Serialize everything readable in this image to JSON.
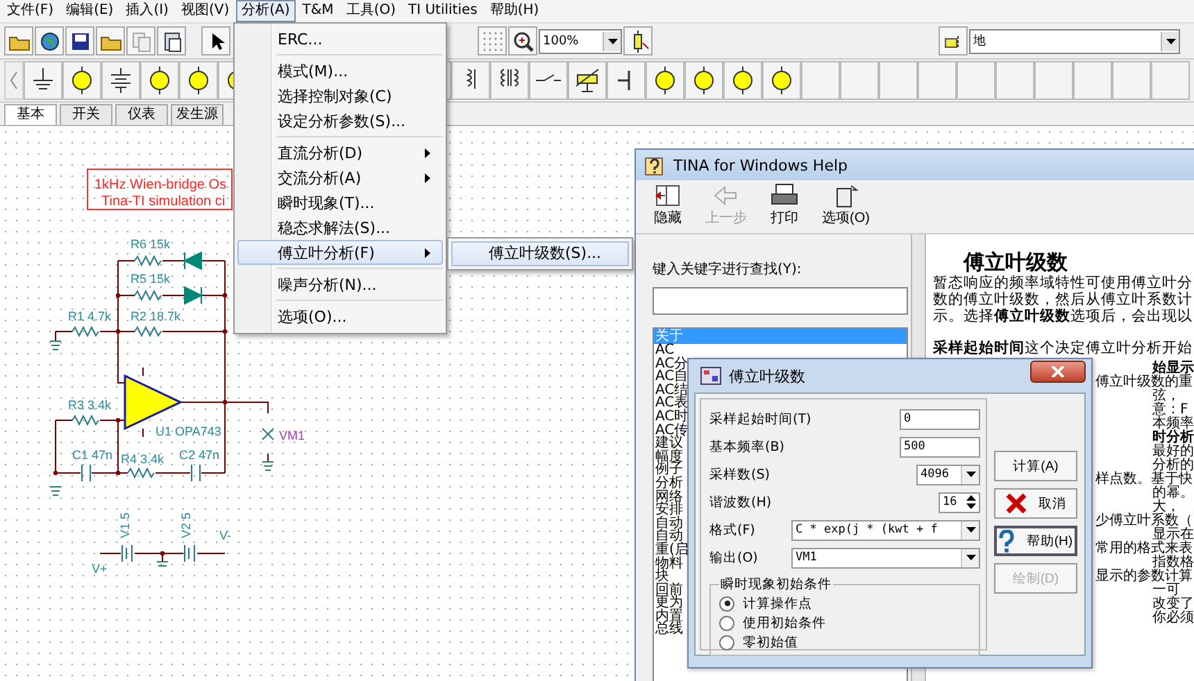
{
  "menubar": [
    {
      "label": "文件(F)",
      "selected": false
    },
    {
      "label": "编辑(E)",
      "selected": false
    },
    {
      "label": "插入(I)",
      "selected": false
    },
    {
      "label": "视图(V)",
      "selected": false
    },
    {
      "label": "分析(A)",
      "selected": true
    },
    {
      "label": "T&M",
      "selected": false
    },
    {
      "label": "工具(O)",
      "selected": false
    },
    {
      "label": "TI Utilities",
      "selected": false
    },
    {
      "label": "帮助(H)",
      "selected": false
    }
  ],
  "toolbar": {
    "zoom": "100%",
    "layer": "地"
  },
  "component_tabs": [
    {
      "label": "基本",
      "selected": true
    },
    {
      "label": "开关",
      "selected": false
    },
    {
      "label": "仪表",
      "selected": false
    },
    {
      "label": "发生源",
      "selected": false
    }
  ],
  "schematic": {
    "note": [
      "1kHz Wien-bridge Os",
      "Tina-TI simulation ci"
    ],
    "labels": [
      "R6 15k",
      "R5 15k",
      "R1 4.7k",
      "R2 18.7k",
      "R3 3.4k",
      "U1 OPA743",
      "C1 47n",
      "R4 3.4k",
      "C2 47n",
      "VM1",
      "V1 5",
      "V2 5",
      "V+",
      "V-"
    ]
  },
  "analysis_menu": [
    {
      "kind": "item",
      "label": "ERC...",
      "submenu": false,
      "selected": false
    },
    {
      "kind": "separator"
    },
    {
      "kind": "item",
      "label": "模式(M)...",
      "submenu": false,
      "selected": false
    },
    {
      "kind": "item",
      "label": "选择控制对象(C)",
      "submenu": false,
      "selected": false
    },
    {
      "kind": "item",
      "label": "设定分析参数(S)...",
      "submenu": false,
      "selected": false
    },
    {
      "kind": "separator"
    },
    {
      "kind": "item",
      "label": "直流分析(D)",
      "submenu": true,
      "selected": false
    },
    {
      "kind": "item",
      "label": "交流分析(A)",
      "submenu": true,
      "selected": false
    },
    {
      "kind": "item",
      "label": "瞬时现象(T)...",
      "submenu": false,
      "selected": false
    },
    {
      "kind": "item",
      "label": "稳态求解法(S)...",
      "submenu": false,
      "selected": false
    },
    {
      "kind": "item",
      "label": "傅立叶分析(F)",
      "submenu": true,
      "selected": true
    },
    {
      "kind": "separator"
    },
    {
      "kind": "item",
      "label": "噪声分析(N)...",
      "submenu": false,
      "selected": false
    },
    {
      "kind": "separator"
    },
    {
      "kind": "item",
      "label": "选项(O)...",
      "submenu": false,
      "selected": false
    }
  ],
  "fourier_submenu": [
    {
      "label": "傅立叶级数(S)...",
      "selected": true
    }
  ],
  "help_window": {
    "title": "TINA for Windows Help",
    "toolbar": [
      {
        "label": "隐藏",
        "disabled": false
      },
      {
        "label": "上一步",
        "disabled": true
      },
      {
        "label": "打印",
        "disabled": false
      },
      {
        "label": "选项(O)",
        "disabled": false
      }
    ],
    "search_label": "键入关键字进行查找(Y):",
    "topics": [
      {
        "label": "关于",
        "selected": true
      },
      {
        "label": "AC",
        "selected": false
      },
      {
        "label": "AC分",
        "selected": false
      },
      {
        "label": "AC自",
        "selected": false
      },
      {
        "label": "AC结",
        "selected": false
      },
      {
        "label": "AC表",
        "selected": false
      },
      {
        "label": "AC时",
        "selected": false
      },
      {
        "label": "AC传",
        "selected": false
      },
      {
        "label": "建议",
        "selected": false
      },
      {
        "label": "幅度",
        "selected": false
      },
      {
        "label": "例子",
        "selected": false
      },
      {
        "label": "分析",
        "selected": false
      },
      {
        "label": "网络",
        "selected": false
      },
      {
        "label": "安排",
        "selected": false
      },
      {
        "label": "自动",
        "selected": false
      },
      {
        "label": "自动",
        "selected": false
      },
      {
        "label": "重(启",
        "selected": false
      },
      {
        "label": "物料",
        "selected": false
      },
      {
        "label": "块",
        "selected": false
      },
      {
        "label": "回前",
        "selected": false
      },
      {
        "label": "更为",
        "selected": false
      },
      {
        "label": "内置",
        "selected": false
      },
      {
        "label": "总线",
        "selected": false
      }
    ],
    "topic_title": "傅立叶级数",
    "paragraphs": [
      "暂态响应的频率域特性可使用傅立叶分",
      "数的傅立叶级数，然后从傅立叶系数计",
      "示。选择**傅立叶级数**选项后，会出现以"
    ],
    "lead": "**采样起始时间**这个决定傅立叶分析开始",
    "fragments": [
      {
        "kind": "indent",
        "text": "始显示",
        "bold": true
      },
      {
        "kind": "flush",
        "text": "傅立叶级数的重",
        "bold": false
      },
      {
        "kind": "indent",
        "text": "弦，",
        "bold": false
      },
      {
        "kind": "indent",
        "text": "意：F",
        "bold": false
      },
      {
        "kind": "indent",
        "text": "本频率",
        "bold": false
      },
      {
        "kind": "indent",
        "text": "时分析",
        "bold": true
      },
      {
        "kind": "indent",
        "text": "最好的",
        "bold": false
      },
      {
        "kind": "indent",
        "text": "分析的",
        "bold": false
      },
      {
        "kind": "flush",
        "text": "样点数。基于快",
        "bold": false
      },
      {
        "kind": "indent",
        "text": "的幂。",
        "bold": false
      },
      {
        "kind": "indent",
        "text": "大，",
        "bold": false
      },
      {
        "kind": "flush",
        "text": "少傅立叶系数（",
        "bold": false
      },
      {
        "kind": "indent",
        "text": "显示在",
        "bold": false
      },
      {
        "kind": "flush",
        "text": "常用的格式来表",
        "bold": false
      },
      {
        "kind": "indent",
        "text": "指数格",
        "bold": false
      },
      {
        "kind": "flush",
        "text": "显示的参数计算",
        "bold": false
      },
      {
        "kind": "indent",
        "text": "一可",
        "bold": false
      },
      {
        "kind": "indent",
        "text": "改变了",
        "bold": false
      },
      {
        "kind": "indent",
        "text": "你必须",
        "bold": false
      }
    ]
  },
  "dialog": {
    "title": "傅立叶级数",
    "fields": [
      {
        "kind": "text",
        "label": "采样起始时间(T)",
        "value": "0"
      },
      {
        "kind": "text",
        "label": "基本频率(B)",
        "value": "500"
      },
      {
        "kind": "combo",
        "label": "采样数(S)",
        "value": "4096"
      },
      {
        "kind": "spin",
        "label": "谐波数(H)",
        "value": "16"
      },
      {
        "kind": "combo",
        "label": "格式(F)",
        "value": "C * exp(j * (kwt + f"
      },
      {
        "kind": "combo",
        "label": "输出(O)",
        "value": "VM1"
      }
    ],
    "group_title": "瞬时现象初始条件",
    "options": [
      {
        "label": "计算操作点",
        "selected": true
      },
      {
        "label": "使用初始条件",
        "selected": false
      },
      {
        "label": "零初始值",
        "selected": false
      }
    ],
    "buttons": [
      {
        "label": "计算(A)",
        "disabled": false,
        "focused": false
      },
      {
        "label": "取消",
        "disabled": false,
        "focused": false
      },
      {
        "label": "帮助(H)",
        "disabled": false,
        "focused": true
      },
      {
        "label": "绘制(D)",
        "disabled": true,
        "focused": false
      }
    ]
  }
}
